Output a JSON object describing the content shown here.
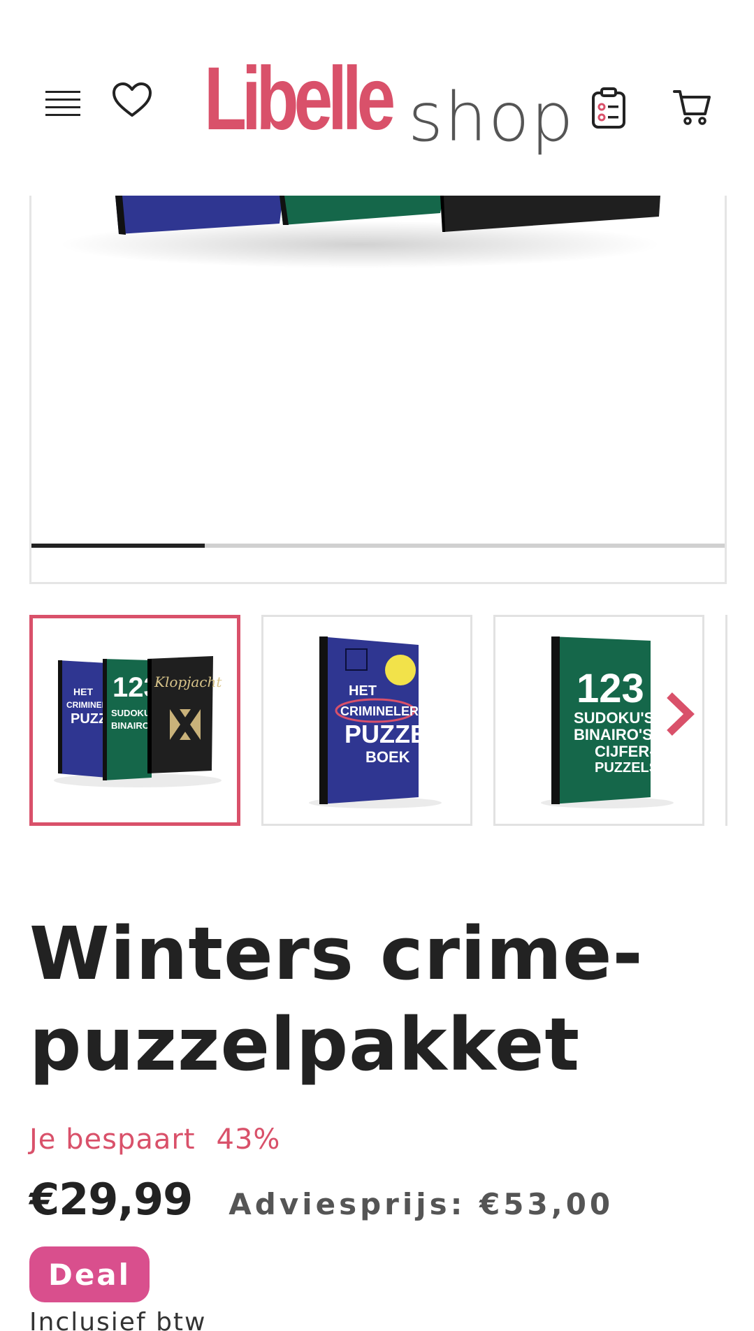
{
  "header": {
    "logo_brand": "Libelle",
    "logo_shop": "shop",
    "icons": {
      "menu": "hamburger-menu-icon",
      "wishlist": "heart-icon",
      "orders": "clipboard-list-icon",
      "cart": "shopping-cart-icon"
    }
  },
  "carousel": {
    "slide_progress": 0.25
  },
  "thumbnails": [
    {
      "alt": "Winters crime-puzzelpakket",
      "active": true
    },
    {
      "alt": "Het Criminelere Puzzelboek",
      "active": false
    },
    {
      "alt": "123 Sudoku's, Binairo's en andere cijferpuzzels",
      "active": false
    }
  ],
  "books": {
    "puzzel": {
      "line1": "HET",
      "line2": "CRIMINELERE",
      "line3": "PUZZEL",
      "line4": "BOEK"
    },
    "sudoku": {
      "line1": "123",
      "line2": "SUDOKU'S,",
      "line3": "BINAIRO'S",
      "line4": "CIJFER-",
      "line5": "PUZZELS"
    },
    "kl": {
      "title": "Klopjacht"
    }
  },
  "product": {
    "title": "Winters crime-puzzelpakket",
    "save_label": "Je bespaart",
    "save_value": "43%",
    "price": "€29,99",
    "advice_price": "Adviesprijs: €53,00",
    "badge": "Deal",
    "vat_note": "Inclusief btw"
  },
  "colors": {
    "brand": "#d9516a",
    "deal": "#d94f8d",
    "text": "#222222"
  }
}
